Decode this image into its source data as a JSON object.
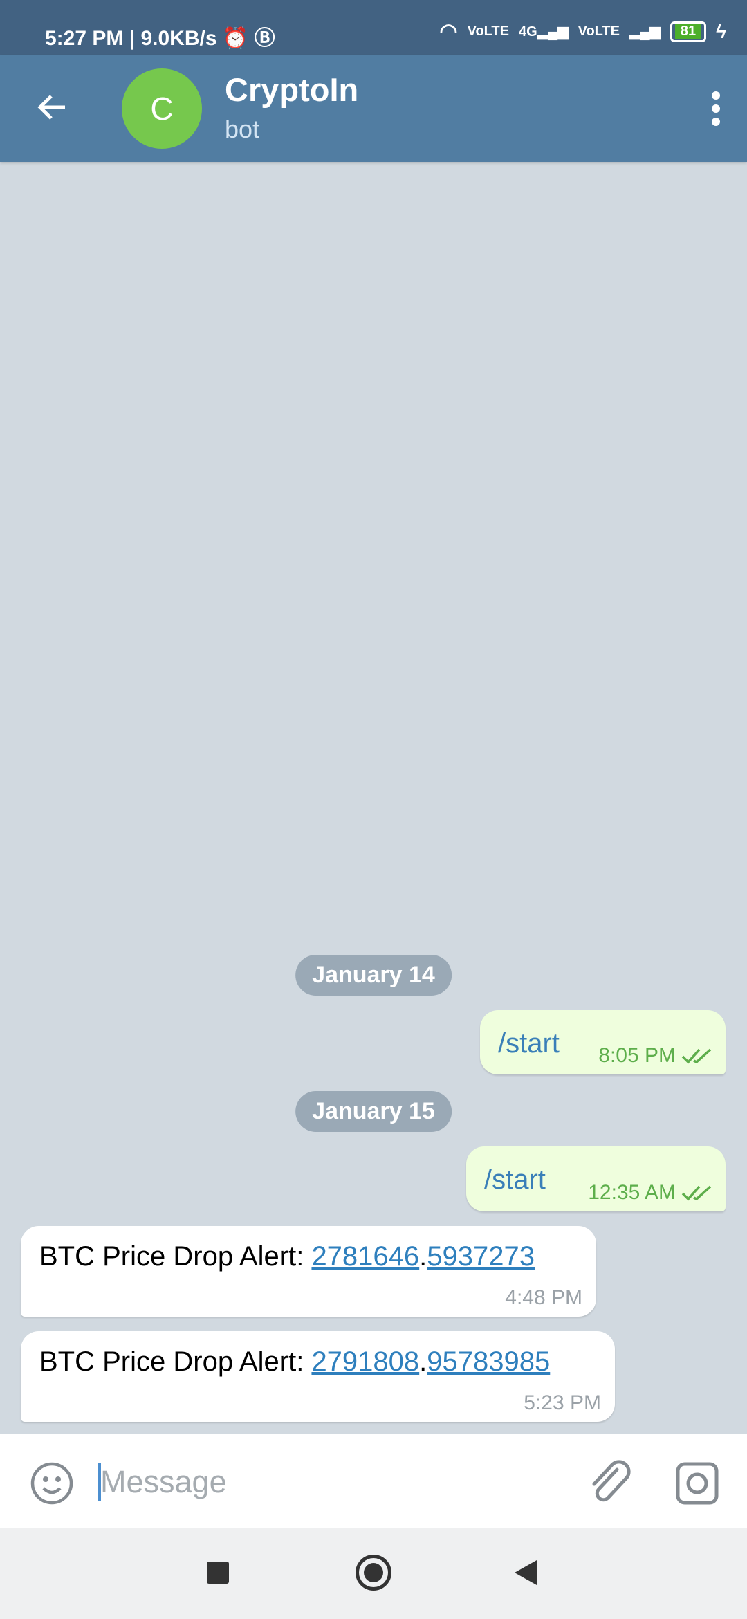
{
  "status_bar": {
    "time": "5:27 PM",
    "speed": "9.0KB/s",
    "network": "4G",
    "battery": "81"
  },
  "header": {
    "avatar_letter": "C",
    "title": "CryptoIn",
    "subtitle": "bot"
  },
  "messages": [
    {
      "type": "date",
      "text": "January 14"
    },
    {
      "type": "outgoing",
      "text": "/start",
      "time": "8:05 PM",
      "status": "read"
    },
    {
      "type": "date",
      "text": "January 15"
    },
    {
      "type": "outgoing",
      "text": "/start",
      "time": "12:35 AM",
      "status": "read"
    },
    {
      "type": "incoming",
      "prefix": "BTC Price Drop Alert: ",
      "link1": "2781646",
      "sep": ".",
      "link2": "5937273",
      "time": "4:48 PM"
    },
    {
      "type": "incoming",
      "prefix": "BTC Price Drop Alert: ",
      "link1": "2791808",
      "sep": ".",
      "link2": "95783985",
      "time": "5:23 PM"
    }
  ],
  "input": {
    "placeholder": "Message"
  },
  "colors": {
    "header": "#517da2",
    "avatar": "#76c84d",
    "outgoing_bubble": "#effedd",
    "link": "#2e7fbd"
  }
}
